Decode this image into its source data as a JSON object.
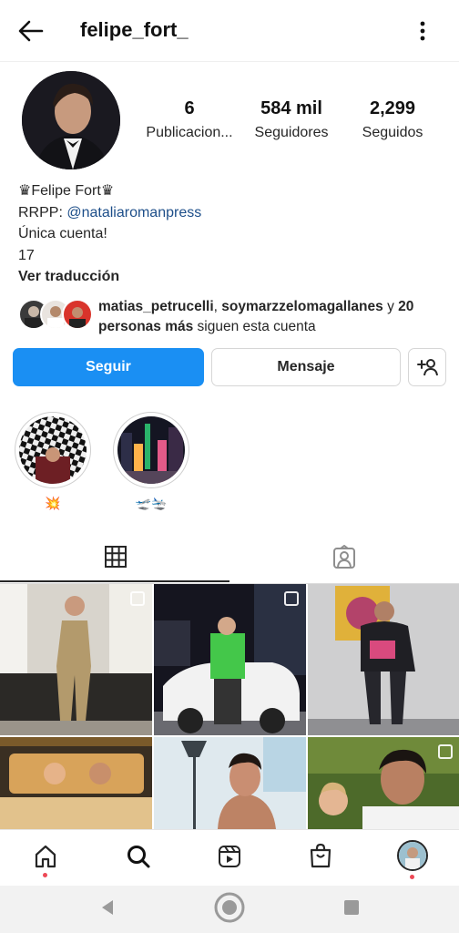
{
  "header": {
    "username": "felipe_fort_"
  },
  "stats": [
    {
      "value": "6",
      "label": "Publicacion..."
    },
    {
      "value": "584 mil",
      "label": "Seguidores"
    },
    {
      "value": "2,299",
      "label": "Seguidos"
    }
  ],
  "bio": {
    "name": "♛Felipe Fort♛",
    "rrpp_prefix": "RRPP: ",
    "rrpp_handle": "@nataliaromanpress",
    "line3": "Única cuenta!",
    "line4": "17",
    "translate": "Ver traducción"
  },
  "followed_by": {
    "user1": "matias_petrucelli",
    "separator": ", ",
    "user2": "soymarzzelomagallanes",
    "connector": " y ",
    "others": "20 personas más",
    "suffix": " siguen esta cuenta"
  },
  "actions": {
    "follow": "Seguir",
    "message": "Mensaje"
  },
  "highlights": [
    {
      "label": "💥"
    },
    {
      "label": "🛫🛬"
    }
  ],
  "colors": {
    "accent": "#1a8ff3",
    "link": "#1d4e89",
    "notification_dot": "#ed4956"
  },
  "icons": {
    "back": "arrow-left-icon",
    "more": "more-vertical-icon",
    "add_person": "add-person-icon",
    "grid": "grid-icon",
    "tagged": "tagged-icon",
    "home": "home-icon",
    "search": "search-icon",
    "reels": "reels-icon",
    "shop": "shop-icon"
  }
}
